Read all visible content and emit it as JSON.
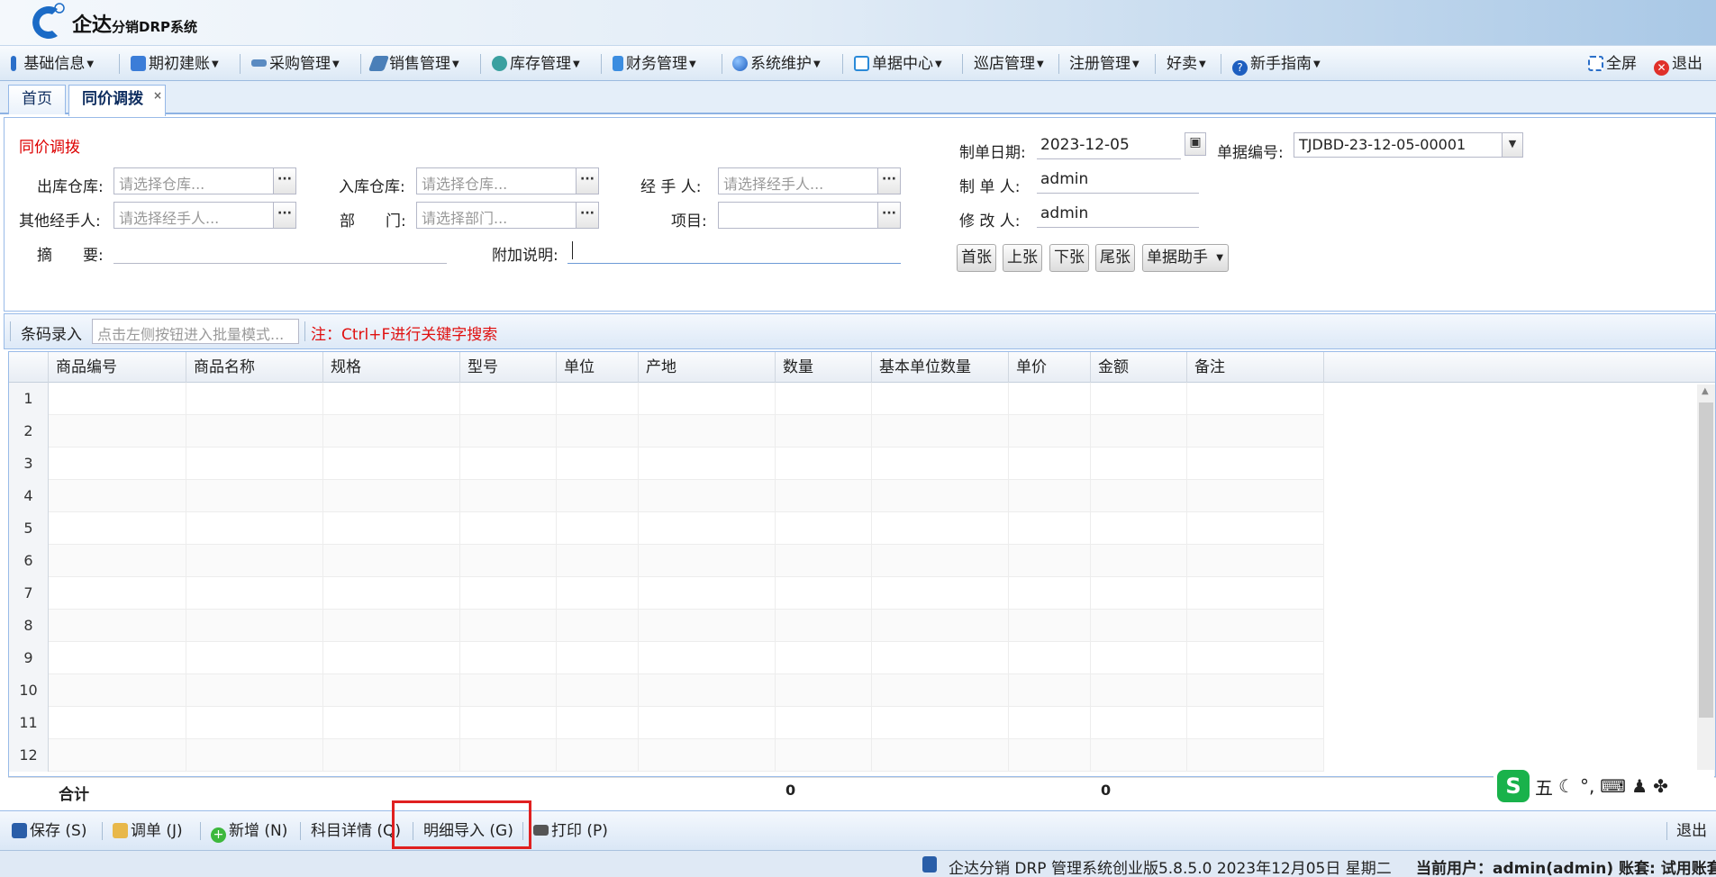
{
  "app": {
    "logo_main": "企达",
    "logo_sub": "分销DRP系统"
  },
  "menu": {
    "items": [
      {
        "label": "基础信息",
        "icon": "book-icon",
        "color": "#2a6fc9"
      },
      {
        "label": "期初建账",
        "icon": "ledger-icon",
        "color": "#3b7dd8"
      },
      {
        "label": "采购管理",
        "icon": "truck-icon",
        "color": "#5a8bc2"
      },
      {
        "label": "销售管理",
        "icon": "sales-icon",
        "color": "#4a7fb8"
      },
      {
        "label": "库存管理",
        "icon": "warehouse-icon",
        "color": "#3aa0a0"
      },
      {
        "label": "财务管理",
        "icon": "finance-icon",
        "color": "#3b8de0"
      },
      {
        "label": "系统维护",
        "icon": "globe-icon",
        "color": "#2a6fc9"
      },
      {
        "label": "单据中心",
        "icon": "document-icon",
        "color": "#2a8ad8"
      },
      {
        "label": "巡店管理",
        "icon": "",
        "color": ""
      },
      {
        "label": "注册管理",
        "icon": "",
        "color": ""
      },
      {
        "label": "好卖",
        "icon": "",
        "color": ""
      },
      {
        "label": "新手指南",
        "icon": "help-icon",
        "color": "#1e5fc0"
      }
    ],
    "fullscreen": "全屏",
    "exit": "退出"
  },
  "tabs": {
    "home": "首页",
    "active": "同价调拨",
    "close_glyph": "×"
  },
  "form": {
    "title": "同价调拨",
    "out_warehouse_label": "出库仓库:",
    "out_warehouse_placeholder": "请选择仓库...",
    "in_warehouse_label": "入库仓库:",
    "in_warehouse_placeholder": "请选择仓库...",
    "handler_label": "经 手 人:",
    "handler_placeholder": "请选择经手人...",
    "other_handler_label": "其他经手人:",
    "other_handler_placeholder": "请选择经手人...",
    "dept_label": "部　　门:",
    "dept_placeholder": "请选择部门...",
    "project_label": "项目:",
    "project_value": "",
    "summary_label": "摘　　要:",
    "summary_value": "",
    "note_label": "附加说明:",
    "note_value": "",
    "date_label": "制单日期:",
    "date_value": "2023-12-05",
    "docno_label": "单据编号:",
    "docno_value": "TJDBD-23-12-05-00001",
    "maker_label": "制 单 人:",
    "maker_value": "admin",
    "modifier_label": "修 改 人:",
    "modifier_value": "admin",
    "dot_glyph": "···"
  },
  "nav_buttons": {
    "first": "首张",
    "prev": "上张",
    "next": "下张",
    "last": "尾张",
    "helper": "单据助手"
  },
  "barcode": {
    "label": "条码录入",
    "placeholder": "点击左侧按钮进入批量模式...",
    "note": "注：Ctrl+F进行关键字搜索"
  },
  "grid": {
    "columns": [
      "商品编号",
      "商品名称",
      "规格",
      "型号",
      "单位",
      "产地",
      "数量",
      "基本单位数量",
      "单价",
      "金额",
      "备注"
    ],
    "rows": [
      "1",
      "2",
      "3",
      "4",
      "5",
      "6",
      "7",
      "8",
      "9",
      "10",
      "11",
      "12"
    ],
    "total_label": "合计",
    "total_qty": "0",
    "total_amount": "0"
  },
  "bottom": {
    "save": "保存 (S)",
    "adjust": "调单 (J)",
    "add": "新增 (N)",
    "subject": "科目详情 (Q)",
    "import": "明细导入 (G)",
    "print": "打印 (P)",
    "exit": "退出"
  },
  "ime": {
    "label": "五"
  },
  "status": {
    "product": "企达分销 DRP 管理系统创业版5.8.5.0 2023年12月05日 星期二",
    "user": "当前用户：admin(admin) 账套: 试用账套"
  }
}
